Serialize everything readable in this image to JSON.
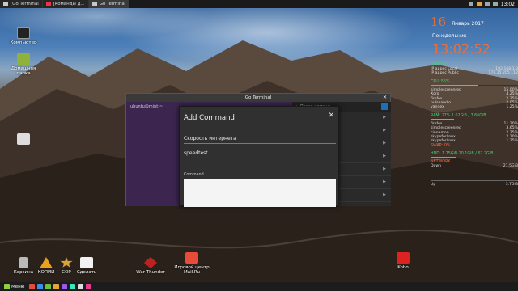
{
  "colors": {
    "accent_orange": "#e8703a",
    "conky_green": "#3cd46b",
    "conky_red": "#ff6a3a",
    "dialog_bg": "#303030",
    "terminal_purple": "#3c2650",
    "focus_blue": "#2d8fd8"
  },
  "top_panel": {
    "tasks": [
      {
        "label": "[Go Terminal",
        "icon": "terminal-icon"
      },
      {
        "label": "[команды д...",
        "icon": "browser-icon"
      },
      {
        "label": "Go Terminal",
        "icon": "terminal-icon"
      }
    ],
    "clock": "13:02"
  },
  "desktop_icons": {
    "computer": "Компьютер",
    "home": "Домашняя папка",
    "trash": "Корзина",
    "kopii": "КОПИИ",
    "cor": "COP",
    "sdelat": "Сделать",
    "war_thunder": "War Thunder",
    "mailru": "Игровой центр Mail.Ru",
    "kobo": "Kobo"
  },
  "conky": {
    "day": "16",
    "month_year": "Январь 2017",
    "weekday": "Понедельник",
    "time": "13:02:52",
    "system_title": "SYSTEM",
    "cpu_title": "CPU: 55%",
    "ram_title": "RAM: 27% 1.62GiB / 7.66GiB",
    "swap_title": "SWAP: 0%",
    "hdd_title": "HDD: 1.75GiB 20.1GiB / 67.2GiB",
    "net_title": "NETWORK",
    "processes": [
      {
        "name": "simplescreenrec",
        "value": "15.00%"
      },
      {
        "name": "Xorg",
        "value": "4.25%"
      },
      {
        "name": "firefox",
        "value": "2.25%"
      },
      {
        "name": "pulseaudio",
        "value": "2.05%"
      },
      {
        "name": "yandex",
        "value": "1.25%"
      }
    ],
    "ram_processes": [
      {
        "name": "firefox",
        "value": "11.20%"
      },
      {
        "name": "simplescreenrec",
        "value": "3.65%"
      },
      {
        "name": "cinnamon",
        "value": "2.25%"
      },
      {
        "name": "skypeforlinux",
        "value": "2.10%"
      },
      {
        "name": "skypeforlinux",
        "value": "1.25%"
      }
    ],
    "ip_local": "192.168.1.3",
    "ip_public": "178.35.205.112",
    "net_rows": [
      {
        "label": "Down",
        "value": "21.5GiB"
      },
      {
        "label": "Up",
        "value": "3.7GiB"
      }
    ],
    "cpu_fill": 0.55,
    "ram_fill": 0.27,
    "hdd_fill": 0.3
  },
  "terminal": {
    "title": "Go Terminal",
    "prompt": "ubuntu@mint:~",
    "search_placeholder": "Поиск команд",
    "command_items": [
      "",
      "",
      "",
      "",
      "",
      "",
      ""
    ]
  },
  "dialog": {
    "title": "Add Command",
    "field1": "Скорость интернета",
    "field2": "speedtest",
    "command_label": "Command"
  },
  "taskbar": {
    "menu_label": "Меню"
  }
}
